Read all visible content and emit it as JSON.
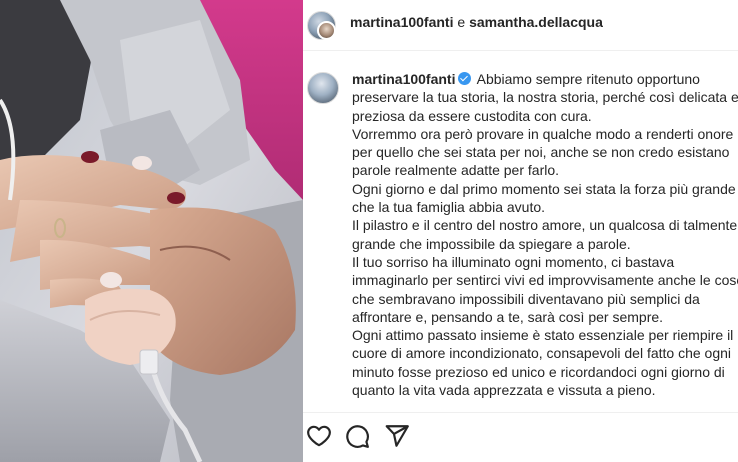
{
  "header": {
    "user1": "martina100fanti",
    "connector": "e",
    "user2": "samantha.dellacqua"
  },
  "post": {
    "username": "martina100fanti",
    "verified": true,
    "caption_lines": [
      "Abbiamo sempre ritenuto opportuno",
      "preservare la tua storia, la nostra storia, perché così delicata e",
      "preziosa da essere custodita con cura.",
      "Vorremmo ora però provare in qualche modo a renderti onore",
      "per quello che sei stata per noi, anche se non credo esistano",
      "parole realmente adatte per farlo.",
      "Ogni giorno e dal primo momento sei stata la forza più grande",
      "che la tua famiglia abbia avuto.",
      "Il pilastro e il centro del nostro amore, un qualcosa di talmente",
      "grande che impossibile da spiegare a parole.",
      "Il tuo sorriso ha illuminato ogni momento, ci bastava",
      "immaginarlo per sentirci vivi ed improvvisamente anche le cose",
      "che sembravano impossibili diventavano più semplici da",
      "affrontare e, pensando a te, sarà così per sempre.",
      "Ogni attimo passato insieme è stato essenziale per riempire il",
      "cuore di amore incondizionato, consapevoli del fatto che ogni",
      "minuto fosse prezioso ed unico e ricordandoci ogni giorno di",
      "quanto la vita vada apprezzata e vissuta a pieno."
    ]
  },
  "actions": {
    "like_icon": "heart-icon",
    "comment_icon": "comment-icon",
    "share_icon": "paper-plane-icon"
  },
  "colors": {
    "text": "#262626",
    "verified_badge": "#3897f0",
    "divider": "#efefef"
  }
}
